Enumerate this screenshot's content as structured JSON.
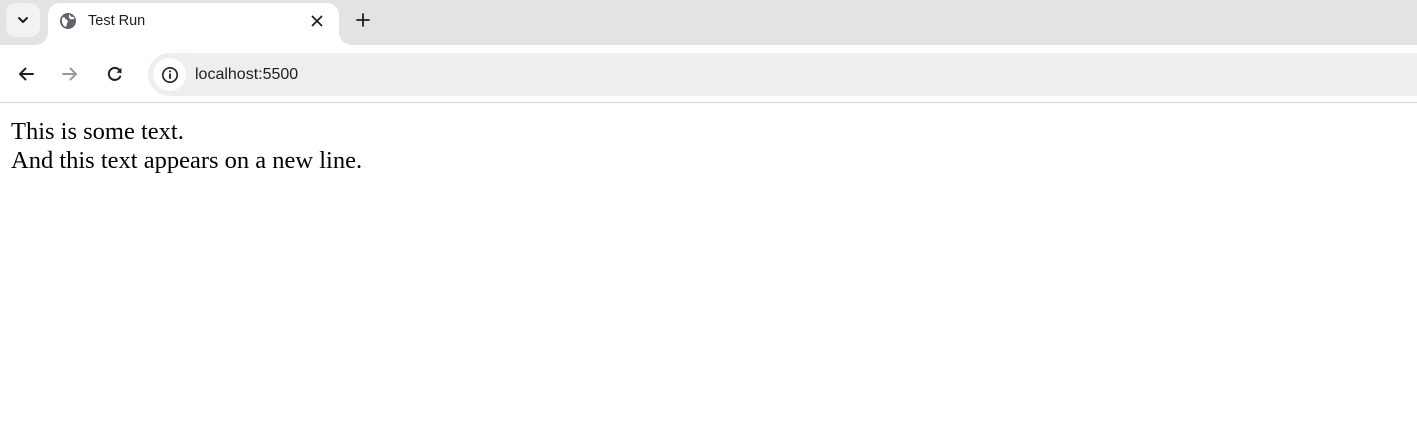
{
  "browser": {
    "tab": {
      "title": "Test Run",
      "favicon": "globe-icon"
    },
    "toolbar": {
      "back_icon": "arrow-left-icon",
      "forward_icon": "arrow-right-icon",
      "reload_icon": "reload-icon",
      "site_info_icon": "info-icon",
      "url": "localhost:5500"
    },
    "colors": {
      "tabstrip_bg": "#e3e3e3",
      "omnibox_bg": "#efeded",
      "active_tab_bg": "#ffffff"
    }
  },
  "page": {
    "line1": "This is some text.",
    "line2": "And this text appears on a new line."
  }
}
